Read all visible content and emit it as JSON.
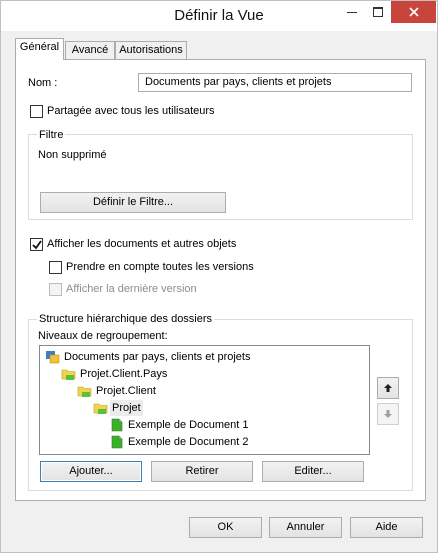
{
  "window": {
    "title": "Définir la Vue"
  },
  "tabs": [
    {
      "label": "Général",
      "active": true
    },
    {
      "label": "Avancé",
      "active": false
    },
    {
      "label": "Autorisations",
      "active": false
    }
  ],
  "general": {
    "name_label": "Nom :",
    "name_value": "Documents par pays, clients et projets",
    "shared_label": "Partagée avec tous les utilisateurs",
    "shared_checked": false,
    "filter": {
      "title": "Filtre",
      "status": "Non supprimé",
      "define_button": "Définir le Filtre..."
    },
    "show_docs_label": "Afficher les documents et autres objets",
    "show_docs_checked": true,
    "all_versions_label": "Prendre en compte toutes les versions",
    "all_versions_checked": false,
    "last_version_label": "Afficher la dernière version",
    "last_version_checked": false,
    "last_version_enabled": false,
    "hierarchy": {
      "title": "Structure hiérarchique des dossiers",
      "levels_label": "Niveaux de regroupement:",
      "tree": [
        {
          "label": "Documents par pays, clients et projets",
          "icon": "view-icon",
          "level": 0
        },
        {
          "label": "Projet.Client.Pays",
          "icon": "grouping-folder-icon",
          "level": 1
        },
        {
          "label": "Projet.Client",
          "icon": "grouping-folder-icon",
          "level": 2
        },
        {
          "label": "Projet",
          "icon": "grouping-folder-icon",
          "level": 3,
          "selected": true
        },
        {
          "label": "Exemple de Document 1",
          "icon": "document-icon",
          "level": 4
        },
        {
          "label": "Exemple de Document 2",
          "icon": "document-icon",
          "level": 4
        }
      ],
      "add_button": "Ajouter...",
      "remove_button": "Retirer",
      "edit_button": "Editer..."
    }
  },
  "footer": {
    "ok": "OK",
    "cancel": "Annuler",
    "help": "Aide"
  }
}
